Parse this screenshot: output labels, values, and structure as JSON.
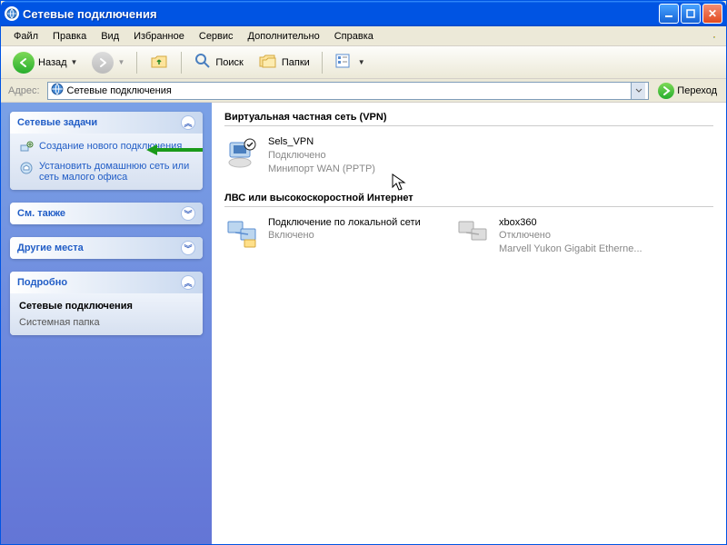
{
  "titlebar": {
    "title": "Сетевые подключения"
  },
  "menu": {
    "file": "Файл",
    "edit": "Правка",
    "view": "Вид",
    "favorites": "Избранное",
    "tools": "Сервис",
    "advanced": "Дополнительно",
    "help": "Справка"
  },
  "toolbar": {
    "back": "Назад",
    "search": "Поиск",
    "folders": "Папки"
  },
  "addressbar": {
    "label": "Адрес:",
    "value": "Сетевые подключения",
    "go": "Переход"
  },
  "sidebar": {
    "tasks": {
      "title": "Сетевые задачи",
      "items": [
        "Создание нового подключения",
        "Установить домашнюю сеть или сеть малого офиса"
      ]
    },
    "seealso": {
      "title": "См. также"
    },
    "otherplaces": {
      "title": "Другие места"
    },
    "details": {
      "title": "Подробно",
      "name": "Сетевые подключения",
      "type": "Системная папка"
    }
  },
  "main": {
    "group_vpn": "Виртуальная частная сеть (VPN)",
    "group_lan": "ЛВС или высокоскоростной Интернет",
    "vpn": {
      "name": "Sels_VPN",
      "status": "Подключено",
      "device": "Минипорт WAN (PPTP)"
    },
    "lan1": {
      "name": "Подключение по локальной сети",
      "status": "Включено",
      "device": ""
    },
    "lan2": {
      "name": "xbox360",
      "status": "Отключено",
      "device": "Marvell Yukon Gigabit Etherne..."
    }
  }
}
